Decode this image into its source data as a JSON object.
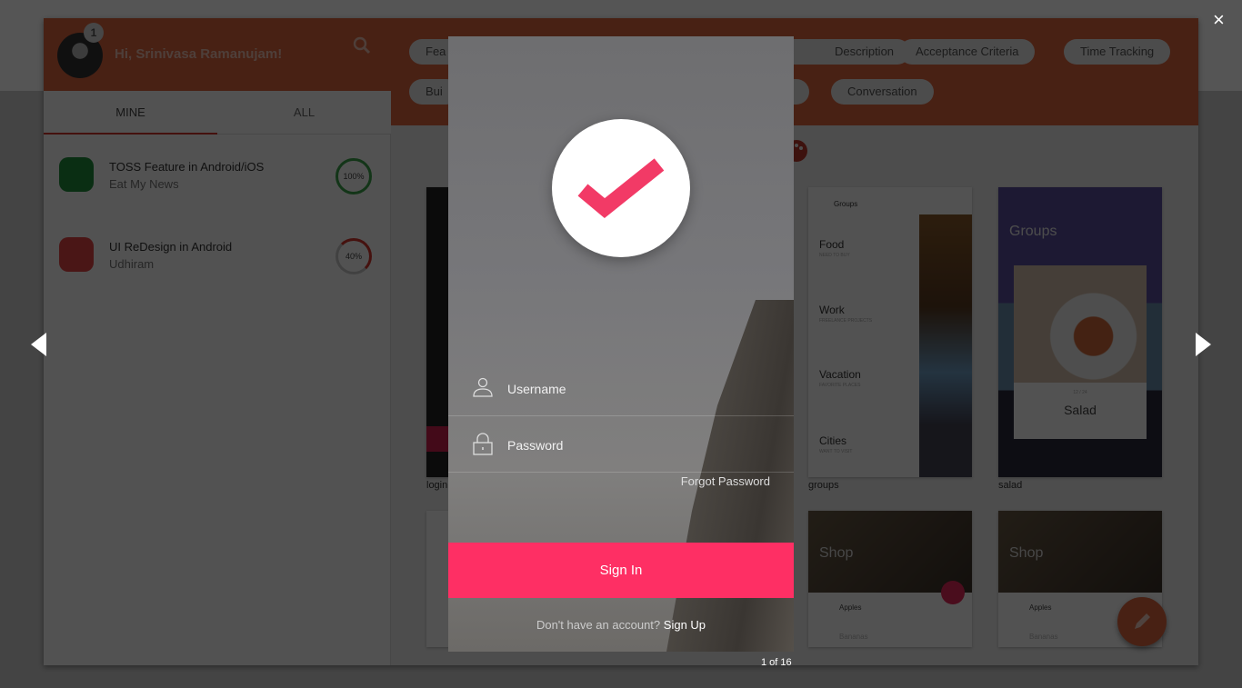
{
  "user": {
    "greeting": "Hi, Srinivasa Ramanujam!",
    "notification_count": "1"
  },
  "tabs": [
    {
      "label": "MINE",
      "active": true
    },
    {
      "label": "ALL",
      "active": false
    }
  ],
  "projects": [
    {
      "title": "TOSS Feature in Android/iOS",
      "client": "Eat My News",
      "progress": "100%",
      "progress_value": 100,
      "color": "#2e9b3a"
    },
    {
      "title": "UI ReDesign in Android",
      "client": "Udhiram",
      "progress": "40%",
      "progress_value": 40,
      "color": "#d9342b"
    }
  ],
  "chips_row1": [
    "Fea",
    "Description",
    "Acceptance Criteria",
    "Time Tracking"
  ],
  "chips_row2": [
    "Bui",
    "Conversation"
  ],
  "thumbnails": {
    "login_caption": "login",
    "groups_caption": "groups",
    "salad_caption": "salad",
    "groups": {
      "header": "Groups",
      "items": [
        {
          "name": "Food",
          "sub": "NEED TO BUY"
        },
        {
          "name": "Work",
          "sub": "FREELANCE PROJECTS"
        },
        {
          "name": "Vacation",
          "sub": "FAVORITE PLACES"
        },
        {
          "name": "Cities",
          "sub": "WANT TO VISIT"
        }
      ]
    },
    "salad": {
      "title": "Groups",
      "count": "12 / 24",
      "card": "Salad"
    },
    "shop": {
      "title": "Shop",
      "item1": "Apples",
      "item2": "Bananas"
    }
  },
  "lightbox": {
    "username_placeholder": "Username",
    "password_placeholder": "Password",
    "forgot": "Forgot Password",
    "sign_in": "Sign In",
    "no_account": "Don't have an account?",
    "sign_up": "Sign Up",
    "counter": "1 of 16",
    "close": "×"
  },
  "colors": {
    "brand": "#e2663f",
    "accent": "#fe2f64"
  }
}
